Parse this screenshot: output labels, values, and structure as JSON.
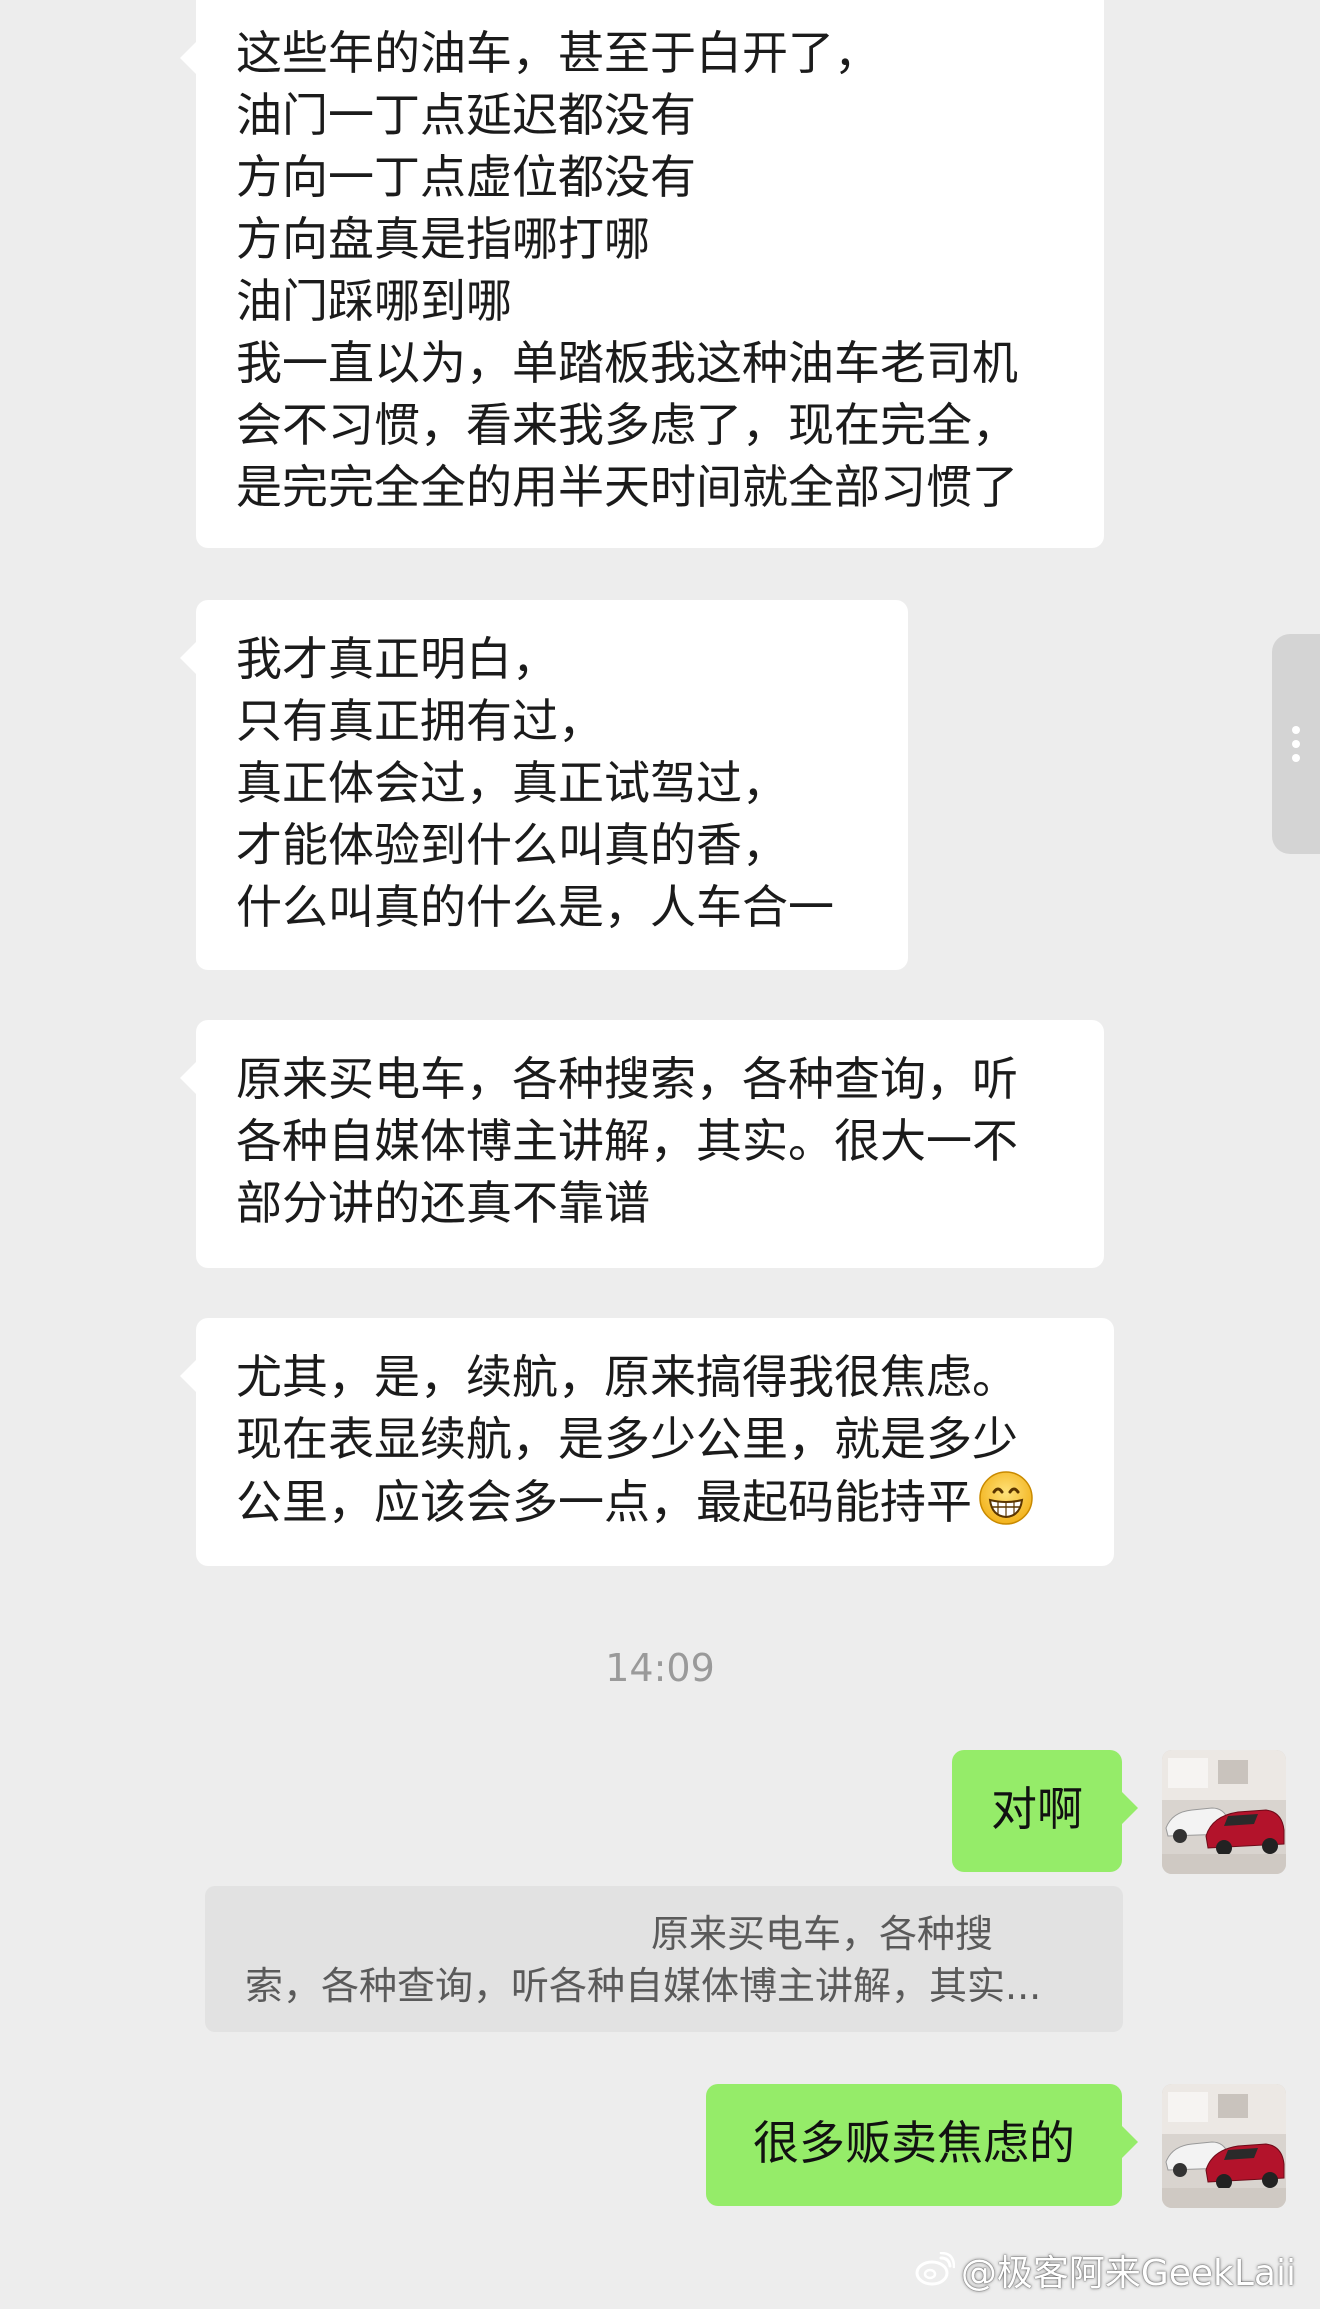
{
  "messages": [
    {
      "lines": [
        "这些年的油车，甚至于白开了，",
        "油门一丁点延迟都没有",
        "方向一丁点虚位都没有",
        "方向盘真是指哪打哪",
        "油门踩哪到哪",
        "我一直以为，单踏板我这种油车老司机",
        "会不习惯，看来我多虑了，现在完全，",
        "是完完全全的用半天时间就全部习惯了"
      ]
    },
    {
      "lines": [
        "我才真正明白，",
        "只有真正拥有过，",
        "真正体会过，真正试驾过，",
        "才能体验到什么叫真的香，",
        "什么叫真的什么是，人车合一"
      ]
    },
    {
      "lines": [
        "原来买电车，各种搜索，各种查询，听",
        "各种自媒体博主讲解，其实。很大一不",
        "部分讲的还真不靠谱"
      ]
    },
    {
      "lines": [
        "尤其，是，续航，原来搞得我很焦虑。",
        "现在表显续航，是多少公里，就是多少",
        "公里，应该会多一点，最起码能持平"
      ],
      "emoji": "grin-emoji"
    }
  ],
  "timestamp": "14:09",
  "replies": [
    {
      "text": "对啊"
    },
    {
      "text": "很多贩卖焦虑的"
    }
  ],
  "quote": {
    "line1": "原来买电车，各种搜",
    "line2": "索，各种查询，听各种自媒体博主讲解，其实..."
  },
  "watermark": "@极客阿来GeekLaii",
  "colors": {
    "background": "#ededed",
    "incoming_bubble": "#ffffff",
    "outgoing_bubble": "#95ec69",
    "quote_background": "#e2e2e2",
    "timestamp_text": "#9a9a9a"
  },
  "icons": {
    "avatar": "car-photo-avatar",
    "watermark": "weibo-icon",
    "side_handle": "more-dots-icon"
  }
}
